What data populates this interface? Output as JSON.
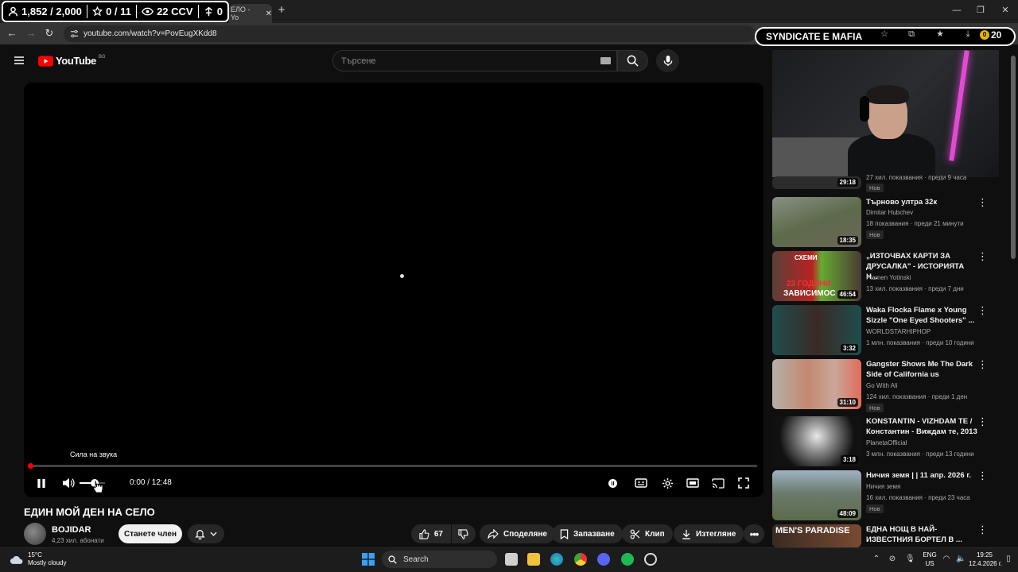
{
  "stream_overlay": {
    "followers": "1,852 / 2,000",
    "goals": "0 / 11",
    "viewers": "22 CCV",
    "other": "0"
  },
  "browser": {
    "tab_title": "ЕЛО - Yo",
    "url": "youtube.com/watch?v=PovEugXKdd8",
    "extension_banner": "SYNDICATE E MAFIA",
    "coin_count": "20",
    "coin_prefix": "0"
  },
  "youtube": {
    "logo_text": "YouTube",
    "country_code": "BG",
    "search_placeholder": "Търсене"
  },
  "player": {
    "tooltip": "Сила на звука",
    "time": "0:00 / 12:48",
    "progress": 0.0,
    "volume": 0.6
  },
  "video": {
    "title": "ЕДИН МОЙ ДЕН НА СЕЛО",
    "channel": "BOJIDAR",
    "subscribers": "4,23 хил. абонати",
    "join_label": "Станете член",
    "likes": "67",
    "share_label": "Споделяне",
    "save_label": "Запазване",
    "clip_label": "Клип",
    "download_label": "Изтегляне"
  },
  "recommendations": [
    {
      "title": "",
      "channel": "",
      "meta": "27 хил. показвания · преди 9 часа",
      "duration": "29:18",
      "badge": "Нов"
    },
    {
      "title": "Търново ултра 32к",
      "channel": "Dimitar Hubchev",
      "meta": "18 показвания · преди 21 минути",
      "duration": "18:35",
      "badge": "Нов"
    },
    {
      "title": "„ИЗТОЧВАХ КАРТИ ЗА ДРУСАЛКА\" - ИСТОРИЯТА Н...",
      "channel": "Plamen Yotinski",
      "meta": "13 хил. показвания · преди 7 дни",
      "duration": "46:54",
      "badge": ""
    },
    {
      "title": "Waka Flocka Flame x Young Sizzle \"One Eyed Shooters\" ...",
      "channel": "WORLDSTARHIPHOP",
      "meta": "1 млн. показвания · преди 10 години",
      "duration": "3:32",
      "badge": ""
    },
    {
      "title": "Gangster Shows Me The Dark Side of California us",
      "channel": "Go With Ali",
      "meta": "124 хил. показвания · преди 1 ден",
      "duration": "31:10",
      "badge": "Нов"
    },
    {
      "title": "KONSTANTIN - VIZHDAM TE / Константин - Виждам те, 2013",
      "channel": "PlanetaOfficial",
      "meta": "3 млн. показвания · преди 13 години",
      "duration": "3:18",
      "badge": ""
    },
    {
      "title": "Ничия земя | | 11 апр. 2026 г.",
      "channel": "Ничия земя",
      "meta": "16 хил. показвания · преди 23 часа",
      "duration": "48:09",
      "badge": "Нов"
    },
    {
      "title": "ЕДНА НОЩ В НАЙ-ИЗВЕСТНИЯ БОРТЕЛ В ...",
      "channel": "",
      "meta": "",
      "duration": "",
      "badge": ""
    }
  ],
  "thumb_texts": {
    "rec3_top": "СХЕМИ",
    "rec3_bottom": "23 ГОДИНИ",
    "rec3_bottom2": "ЗАВИСИМОС",
    "rec8": "MEN'S PARADISE"
  },
  "taskbar": {
    "temperature": "15°C",
    "weather": "Mostly cloudy",
    "search_label": "Search",
    "lang_1": "ENG",
    "lang_2": "US",
    "time": "19:25",
    "date": "12.4.2026 г."
  },
  "colors": {
    "accent_red": "#ff0000",
    "background": "#0f0f0f",
    "webcam_light": "#e14bd3"
  }
}
